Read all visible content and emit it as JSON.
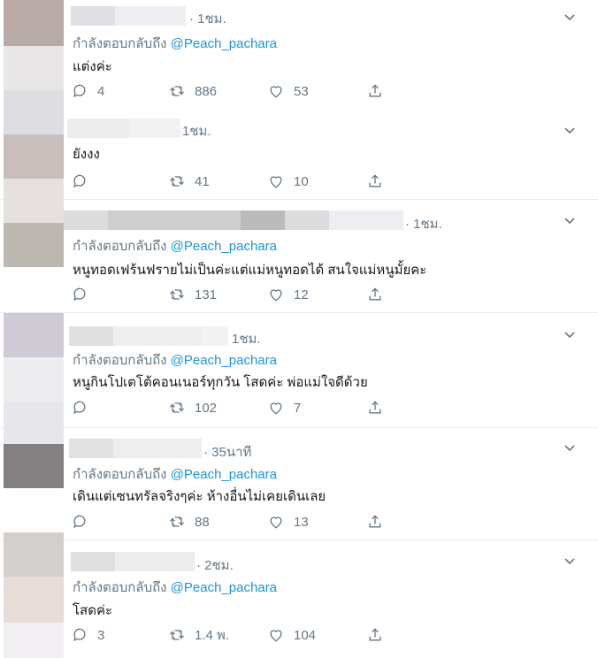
{
  "colors": {
    "link": "#1b95e0",
    "secondary": "#657786",
    "text": "#14171a",
    "separator": "#e6ecf0"
  },
  "icons": {
    "reply": "reply-icon",
    "retweet": "retweet-icon",
    "like": "heart-icon",
    "share": "share-icon",
    "menu": "chevron-down-icon"
  },
  "tweets": [
    {
      "time": "· 1ชม.",
      "replying_to": "กำลังตอบกลับถึง",
      "handle": "@Peach_pachara",
      "text": "แต่งค่ะ",
      "replies": "4",
      "retweets": "886",
      "likes": "53"
    },
    {
      "time": "1ชม.",
      "replying_to": "",
      "handle": "",
      "text": "ยังงง",
      "replies": "",
      "retweets": "41",
      "likes": "10"
    },
    {
      "time": "· 1ชม.",
      "replying_to": "กำลังตอบกลับถึง",
      "handle": "@Peach_pachara",
      "text": "หนูทอดเฟร้นฟรายไม่เป็นค่ะแต่แม่หนูทอดได้ สนใจแม่หนูมั้ยคะ",
      "replies": "",
      "retweets": "131",
      "likes": "12"
    },
    {
      "time": "1ชม.",
      "replying_to": "กำลังตอบกลับถึง",
      "handle": "@Peach_pachara",
      "text": "หนูกินโปเตโต้คอนเนอร์ทุกวัน โสดค่ะ พ่อแม่ใจดีด้วย",
      "replies": "",
      "retweets": "102",
      "likes": "7"
    },
    {
      "time": "· 35นาที",
      "replying_to": "กำลังตอบกลับถึง",
      "handle": "@Peach_pachara",
      "text": "เดินแต่เซนทรัลจริงๆค่ะ ห้างอื่นไม่เคยเดินเลย",
      "replies": "",
      "retweets": "88",
      "likes": "13"
    },
    {
      "time": "· 2ชม.",
      "replying_to": "กำลังตอบกลับถึง",
      "handle": "@Peach_pachara",
      "text": "โสดค่ะ",
      "replies": "3",
      "retweets": "1.4 พ.",
      "likes": "104"
    }
  ]
}
